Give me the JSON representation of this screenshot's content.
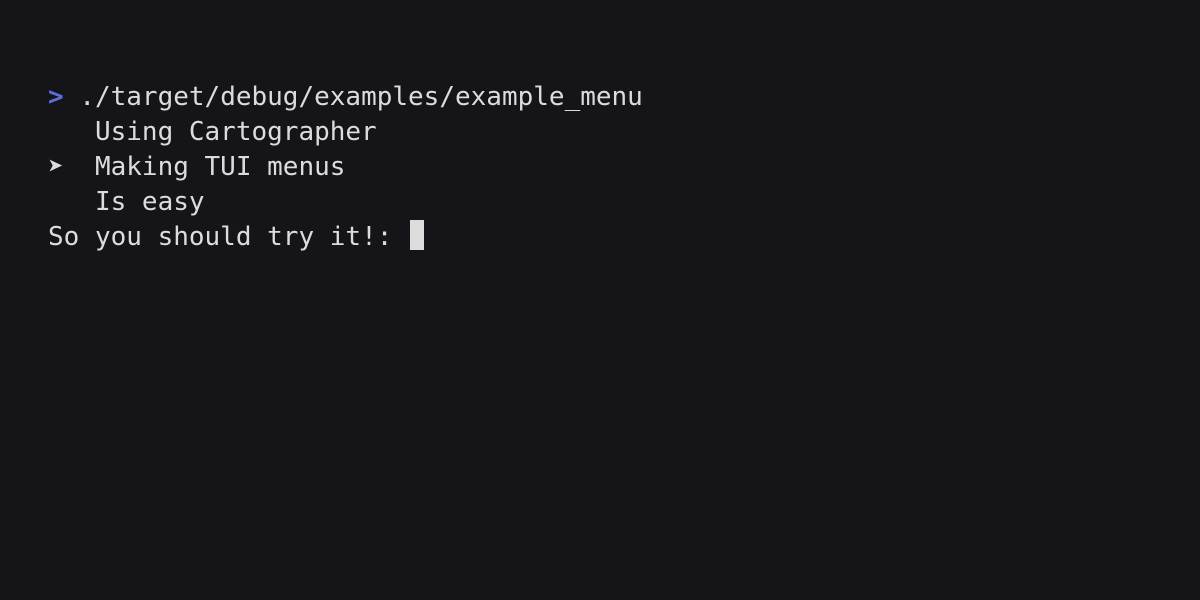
{
  "prompt": {
    "symbol": ">",
    "command": "./target/debug/examples/example_menu"
  },
  "menu": {
    "items": [
      {
        "pointer": "",
        "label": "Using Cartographer"
      },
      {
        "pointer": "➤",
        "label": "Making TUI menus"
      },
      {
        "pointer": "",
        "label": "Is easy"
      }
    ]
  },
  "input_line": {
    "prompt_text": "So you should try it!: "
  },
  "colors": {
    "background": "#151519",
    "foreground": "#dcdcdc",
    "prompt_accent": "#5b6ee1"
  }
}
